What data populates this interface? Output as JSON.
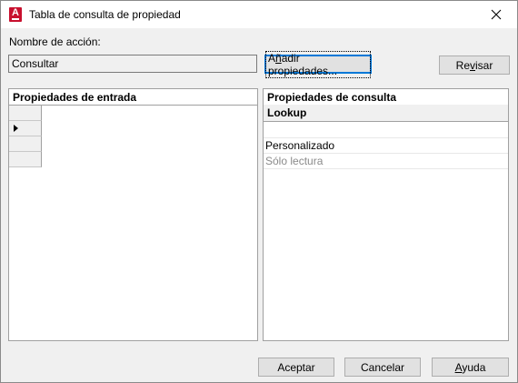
{
  "window": {
    "title": "Tabla de consulta de propiedad",
    "icon": "autocad-app-icon",
    "icon_letter": "A",
    "accent": "#c8102e"
  },
  "action": {
    "label": "Nombre de acción:",
    "value": "Consultar"
  },
  "buttons": {
    "add_properties": {
      "pre": "A",
      "u": "ñ",
      "post": "adir propiedades..."
    },
    "review": {
      "pre": "Re",
      "u": "v",
      "post": "isar"
    },
    "ok": "Aceptar",
    "cancel": "Cancelar",
    "help": {
      "pre": "",
      "u": "A",
      "post": "yuda"
    }
  },
  "input_panel": {
    "header": "Propiedades de entrada",
    "rows": 4,
    "selected_row": 1
  },
  "lookup_panel": {
    "header": "Propiedades de consulta",
    "column": "Lookup",
    "items": [
      {
        "label": "",
        "disabled": false
      },
      {
        "label": "Personalizado",
        "disabled": false
      },
      {
        "label": "Sólo lectura",
        "disabled": true
      }
    ]
  }
}
